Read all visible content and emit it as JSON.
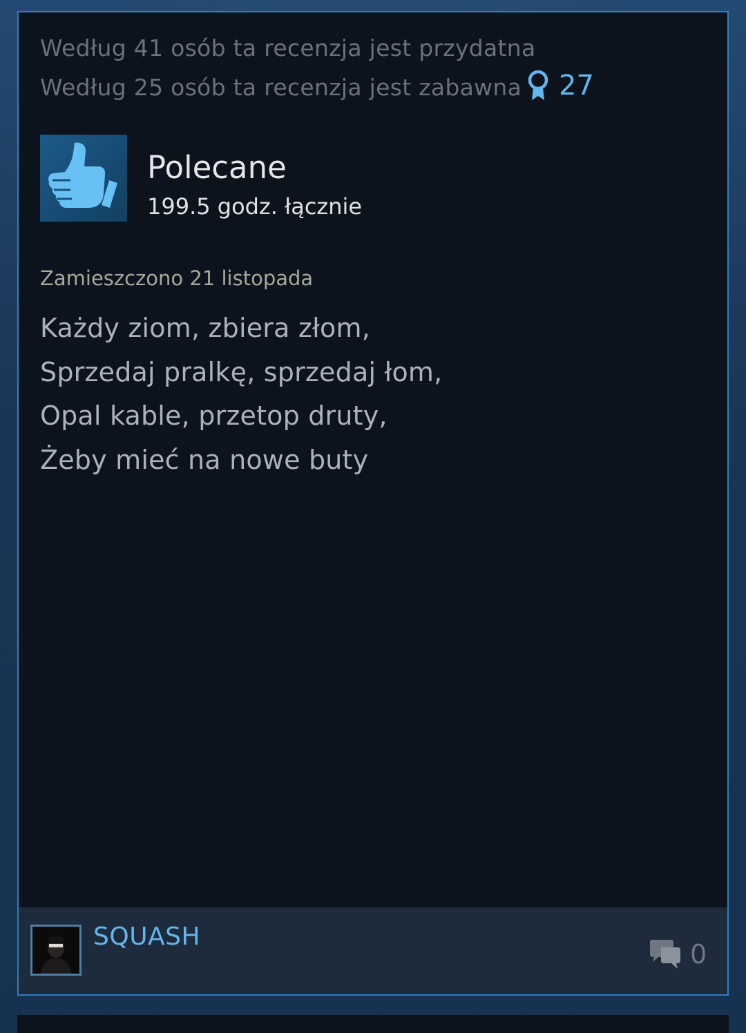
{
  "colors": {
    "accent": "#5fb6ef",
    "card_border": "#2f7fbf",
    "card_bg": "#0d131c",
    "author_bar_bg": "#1d2b3d",
    "muted_text": "#6b717a",
    "review_text": "#a9b2bd"
  },
  "review": {
    "helpful_line": "Według 41 osób ta recenzja jest przydatna",
    "funny_line": "Według 25 osób ta recenzja jest zabawna",
    "award": {
      "icon": "award-ribbon-icon",
      "count": "27"
    },
    "recommendation": {
      "icon": "thumbs-up-icon",
      "title": "Polecane",
      "hours": "199.5 godz. łącznie"
    },
    "posted": "Zamieszczono 21 listopada",
    "text_lines": [
      "Każdy ziom, zbiera złom,",
      "Sprzedaj pralkę, sprzedaj łom,",
      "Opal kable, przetop druty,",
      "Żeby mieć na nowe buty"
    ]
  },
  "author": {
    "avatar_icon": "user-avatar",
    "name": "SQUASH",
    "comments_icon": "comment-bubbles-icon",
    "comments_count": "0"
  }
}
